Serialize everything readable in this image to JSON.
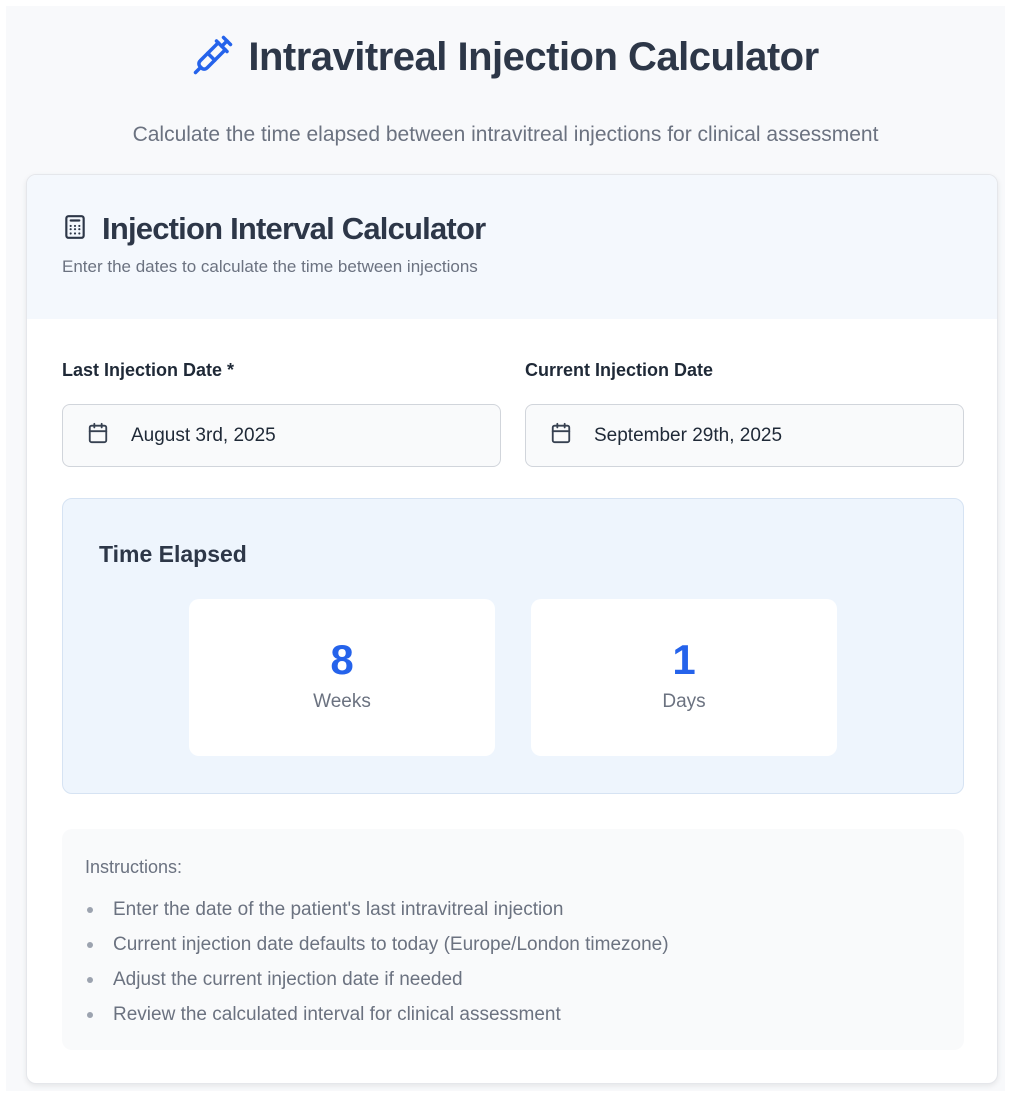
{
  "header": {
    "title": "Intravitreal Injection Calculator",
    "icon": "syringe-icon",
    "subtitle": "Calculate the time elapsed between intravitreal injections for clinical assessment"
  },
  "card": {
    "icon": "calculator-icon",
    "title": "Injection Interval Calculator",
    "description": "Enter the dates to calculate the time between injections"
  },
  "fields": {
    "last": {
      "label": "Last Injection Date *",
      "value": "August 3rd, 2025",
      "icon": "calendar-icon"
    },
    "current": {
      "label": "Current Injection Date",
      "value": "September 29th, 2025",
      "icon": "calendar-icon"
    }
  },
  "result": {
    "title": "Time Elapsed",
    "weeks": {
      "value": "8",
      "label": "Weeks"
    },
    "days": {
      "value": "1",
      "label": "Days"
    }
  },
  "instructions": {
    "title": "Instructions:",
    "items": [
      "Enter the date of the patient's last intravitreal injection",
      "Current injection date defaults to today (Europe/London timezone)",
      "Adjust the current injection date if needed",
      "Review the calculated interval for clinical assessment"
    ]
  },
  "colors": {
    "accent": "#2563eb",
    "heading": "#2d3748",
    "muted": "#6b7280",
    "result_bg": "#eef5fd"
  }
}
